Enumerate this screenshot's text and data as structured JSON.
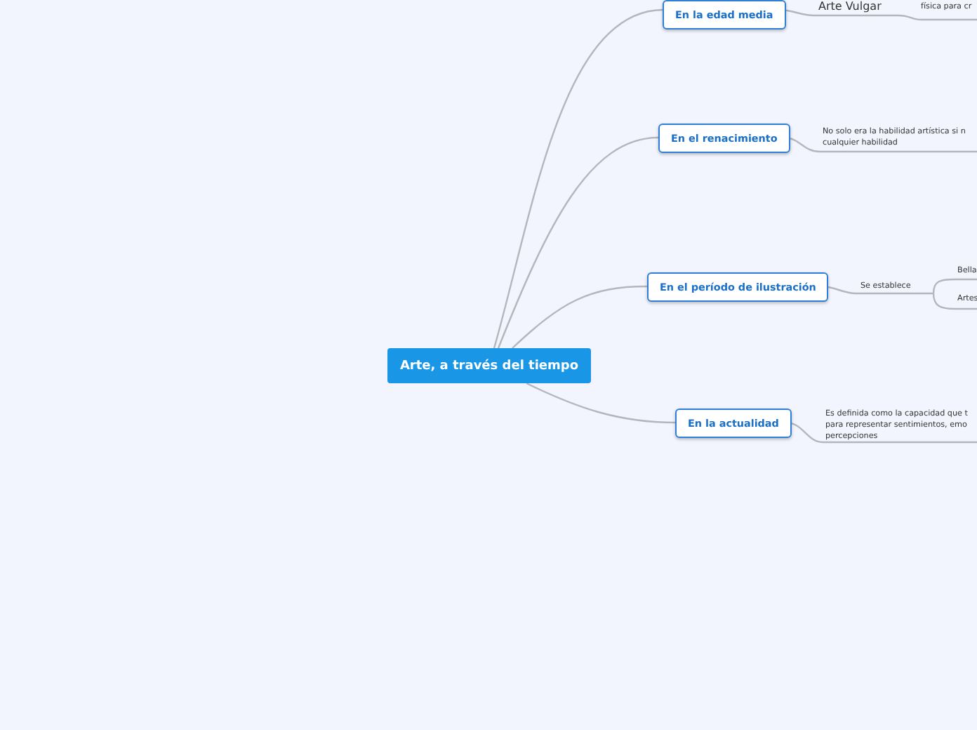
{
  "central_topic": {
    "label": "Arte, a través del tiempo"
  },
  "topics": [
    {
      "label": "En la edad media",
      "subtopics": [
        {
          "label": "Arte Vulgar",
          "subtopics": [
            {
              "label": "física para cr"
            }
          ]
        }
      ]
    },
    {
      "label": "En el renacimiento",
      "subtopics": [
        {
          "label": "No solo era la habilidad artística si n\ncualquier habilidad"
        }
      ]
    },
    {
      "label": "En el período de ilustración",
      "subtopics": [
        {
          "label": "Se establece",
          "subtopics": [
            {
              "label": "Bella"
            },
            {
              "label": "Artes"
            }
          ]
        }
      ]
    },
    {
      "label": "En la actualidad",
      "subtopics": [
        {
          "label": "Es definida como la capacidad que t\npara representar sentimientos, emo\npercepciones"
        }
      ]
    }
  ]
}
